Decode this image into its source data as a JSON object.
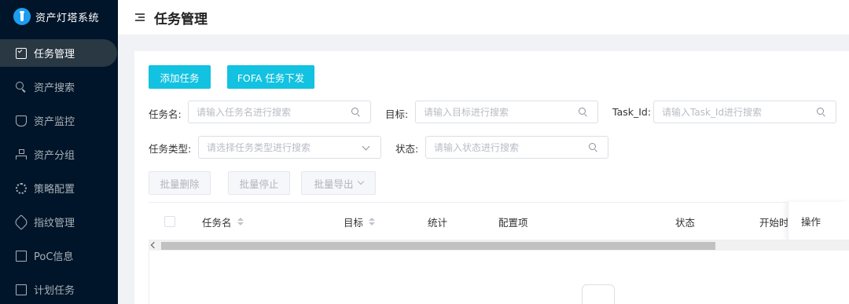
{
  "app": {
    "title": "资产灯塔系统"
  },
  "sidebar": {
    "items": [
      {
        "label": "任务管理",
        "icon": "task-icon",
        "active": true
      },
      {
        "label": "资产搜索",
        "icon": "search-icon"
      },
      {
        "label": "资产监控",
        "icon": "shield-icon"
      },
      {
        "label": "资产分组",
        "icon": "org-icon"
      },
      {
        "label": "策略配置",
        "icon": "gear-icon"
      },
      {
        "label": "指纹管理",
        "icon": "tag-icon"
      },
      {
        "label": "PoC信息",
        "icon": "doc-icon"
      },
      {
        "label": "计划任务",
        "icon": "terminal-icon"
      }
    ]
  },
  "header": {
    "title": "任务管理",
    "menu_icon": "collapse-menu-icon"
  },
  "toolbar": {
    "add_task": "添加任务",
    "fofa_task": "FOFA 任务下发"
  },
  "filters": {
    "task_name": {
      "label": "任务名:",
      "placeholder": "请输入任务名进行搜索"
    },
    "target": {
      "label": "目标:",
      "placeholder": "请输入目标进行搜索"
    },
    "task_id": {
      "label": "Task_Id:",
      "placeholder": "请输入Task_Id进行搜索"
    },
    "task_type": {
      "label": "任务类型:",
      "placeholder": "请选择任务类型进行搜索"
    },
    "status": {
      "label": "状态:",
      "placeholder": "请输入状态进行搜索"
    }
  },
  "batch": {
    "delete": "批量删除",
    "stop": "批量停止",
    "export": "批量导出"
  },
  "table": {
    "columns": [
      "任务名",
      "目标",
      "统计",
      "配置项",
      "状态",
      "开始时",
      "操作"
    ]
  },
  "colors": {
    "sidebar_bg": "#001529",
    "primary": "#12c2e0"
  }
}
